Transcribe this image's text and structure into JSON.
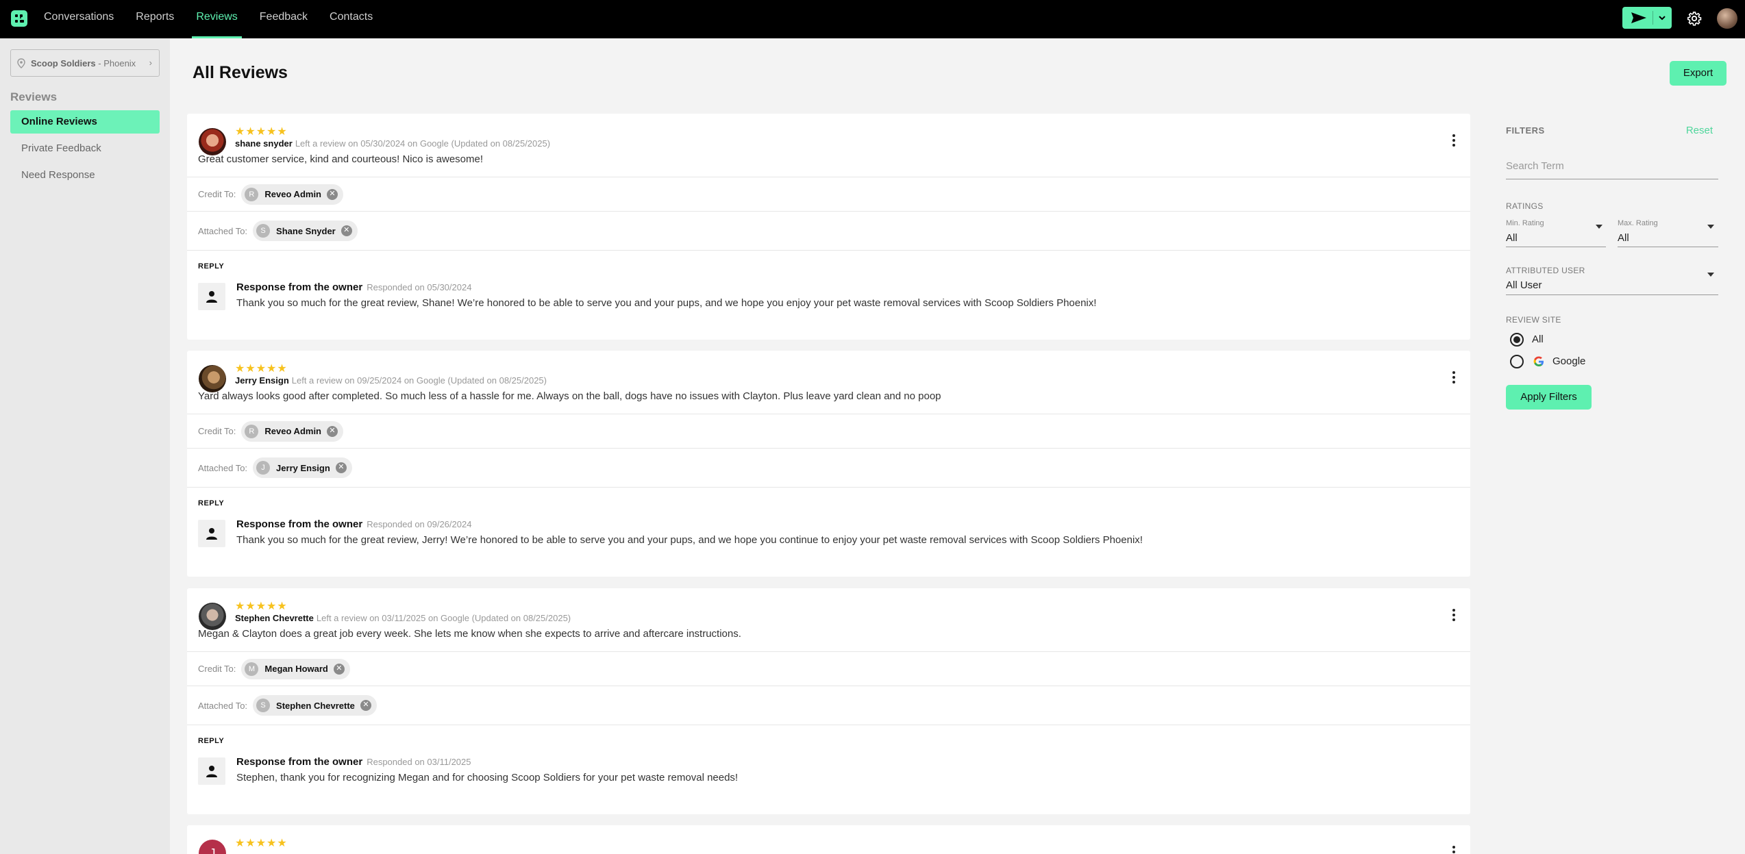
{
  "nav": {
    "items": [
      "Conversations",
      "Reports",
      "Reviews",
      "Feedback",
      "Contacts"
    ],
    "active": "Reviews"
  },
  "sidebar": {
    "location": {
      "name": "Scoop Soldiers",
      "city": "- Phoenix"
    },
    "title": "Reviews",
    "items": [
      {
        "label": "Online Reviews",
        "active": true
      },
      {
        "label": "Private Feedback",
        "active": false
      },
      {
        "label": "Need Response",
        "active": false
      }
    ]
  },
  "page": {
    "title": "All Reviews",
    "export_label": "Export"
  },
  "reviews": [
    {
      "stars": "★★★★★",
      "rating": 5,
      "name": "shane snyder",
      "meta": "Left a review on 05/30/2024 on Google (Updated on 08/25/2025)",
      "text": "Great customer service, kind and courteous! Nico is awesome!",
      "credit_label": "Credit To:",
      "credit": {
        "initial": "R",
        "name": "Reveo Admin"
      },
      "attached_label": "Attached To:",
      "attached": {
        "initial": "S",
        "name": "Shane Snyder"
      },
      "reply_label": "REPLY",
      "response_title": "Response from the owner",
      "response_date": "Responded on 05/30/2024",
      "response_text": "Thank you so much for the great review, Shane! We’re honored to be able to serve you and your pups, and we hope you enjoy your pet waste removal services with Scoop Soldiers Phoenix!"
    },
    {
      "stars": "★★★★★",
      "rating": 5,
      "name": "Jerry Ensign",
      "meta": "Left a review on 09/25/2024 on Google (Updated on 08/25/2025)",
      "text": "Yard always looks good after completed. So much less of a hassle for me. Always on the ball, dogs have no issues with Clayton. Plus leave yard clean and no poop",
      "credit_label": "Credit To:",
      "credit": {
        "initial": "R",
        "name": "Reveo Admin"
      },
      "attached_label": "Attached To:",
      "attached": {
        "initial": "J",
        "name": "Jerry Ensign"
      },
      "reply_label": "REPLY",
      "response_title": "Response from the owner",
      "response_date": "Responded on 09/26/2024",
      "response_text": "Thank you so much for the great review, Jerry! We’re honored to be able to serve you and your pups, and we hope you continue to enjoy your pet waste removal services with Scoop Soldiers Phoenix!"
    },
    {
      "stars": "★★★★★",
      "rating": 5,
      "name": "Stephen Chevrette",
      "meta": "Left a review on 03/11/2025 on Google (Updated on 08/25/2025)",
      "text": "Megan & Clayton does a great job every week. She lets me know when she expects to arrive and aftercare instructions.",
      "credit_label": "Credit To:",
      "credit": {
        "initial": "M",
        "name": "Megan Howard"
      },
      "attached_label": "Attached To:",
      "attached": {
        "initial": "S",
        "name": "Stephen Chevrette"
      },
      "reply_label": "REPLY",
      "response_title": "Response from the owner",
      "response_date": "Responded on 03/11/2025",
      "response_text": "Stephen, thank you for recognizing Megan and for choosing Scoop Soldiers for your pet waste removal needs!"
    },
    {
      "stars": "★★★★★",
      "rating": 5,
      "avatar_initial": "J"
    }
  ],
  "filters": {
    "title": "FILTERS",
    "reset": "Reset",
    "search_placeholder": "Search Term",
    "ratings_label": "RATINGS",
    "min_label": "Min. Rating",
    "min_value": "All",
    "max_label": "Max. Rating",
    "max_value": "All",
    "user_label": "ATTRIBUTED USER",
    "user_value": "All User",
    "site_label": "REVIEW SITE",
    "sites": [
      {
        "label": "All",
        "selected": true
      },
      {
        "label": "Google",
        "selected": false
      }
    ],
    "apply": "Apply Filters"
  },
  "colors": {
    "accent": "#5ef0b0",
    "star": "#f7c21f",
    "topbar": "#000000"
  }
}
